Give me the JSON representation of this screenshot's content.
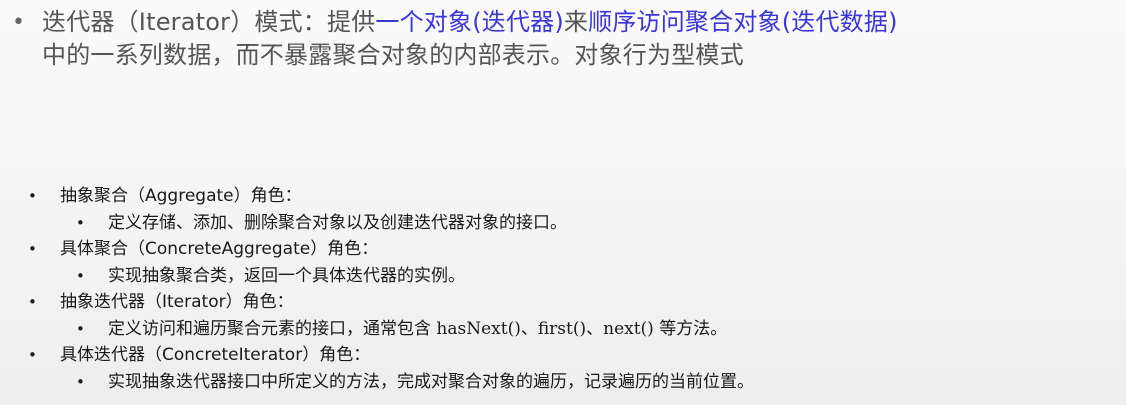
{
  "intro": {
    "bullet": "•",
    "part1": "迭代器（Iterator）模式：提供",
    "part2": "一个对象(迭代器)",
    "part3": "来",
    "part4": "顺序访问聚合对象(迭代数据)",
    "line2": "中的一系列数据，而不暴露聚合对象的内部表示。对象行为型模式",
    "accent_color": "#3b36d6"
  },
  "roles": [
    {
      "bullet": "•",
      "title_pre": "抽象聚合（",
      "title_en": "Aggregate",
      "title_post": "）角色：",
      "desc": "定义存储、添加、删除聚合对象以及创建迭代器对象的接口。"
    },
    {
      "bullet": "•",
      "title_pre": "具体聚合（",
      "title_en": "ConcreteAggregate",
      "title_post": "）角色：",
      "desc": "实现抽象聚合类，返回一个具体迭代器的实例。"
    },
    {
      "bullet": "•",
      "title_pre": "抽象迭代器（",
      "title_en": "Iterator",
      "title_post": "）角色：",
      "desc": "定义访问和遍历聚合元素的接口，通常包含 hasNext()、first()、next() 等方法。"
    },
    {
      "bullet": "•",
      "title_pre": "具体迭代器（",
      "title_en": "ConcreteIterator",
      "title_post": "）角色：",
      "desc": "实现抽象迭代器接口中所定义的方法，完成对聚合对象的遍历，记录遍历的当前位置。"
    }
  ]
}
